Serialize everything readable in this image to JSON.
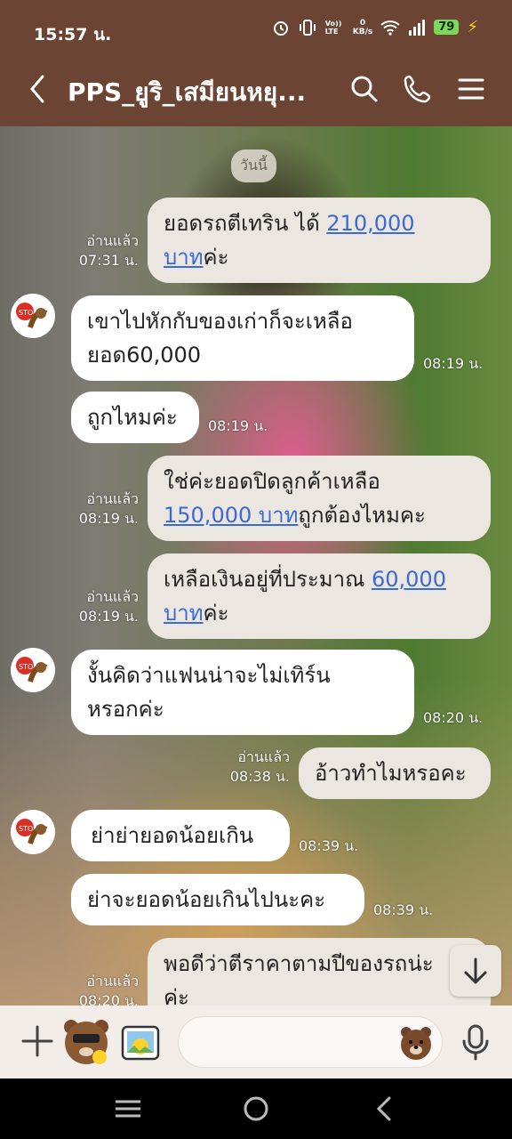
{
  "status_bar": {
    "time": "15:57 น.",
    "net_up": "0",
    "net_unit": "KB/s",
    "volte": "Vo)) LTE",
    "battery": "79",
    "icons": [
      "alarm-icon",
      "vibrate-icon",
      "volte-icon",
      "wifi-icon",
      "signal-icon",
      "battery-icon",
      "charging-icon"
    ]
  },
  "header": {
    "title": "PPS_ยูริ_เสมียนหยุ...",
    "icons": [
      "back-icon",
      "search-icon",
      "call-icon",
      "menu-icon"
    ]
  },
  "chat": {
    "date_chip": "วันนี้",
    "messages": [
      {
        "dir": "out",
        "read": "อ่านแล้ว",
        "time": "07:31 น.",
        "text1": "ยอดรถตีเทริน ได้ ",
        "link1": "210,000",
        "text2": "",
        "link2": "บาท",
        "text3": "ค่ะ"
      },
      {
        "dir": "in",
        "time": "08:19 น.",
        "line1": "เขาไปหักกับของเก่าก็จะเหลือ",
        "line2": "ยอด60,000"
      },
      {
        "dir": "in",
        "time": "08:19 น.",
        "line1": "ถูกไหมค่ะ"
      },
      {
        "dir": "out",
        "read": "อ่านแล้ว",
        "time": "08:19 น.",
        "line1": "ใช่ค่ะยอดปิดลูกค้าเหลือ",
        "link": "150,000 บาท",
        "tail": "ถูกต้องไหมคะ"
      },
      {
        "dir": "out",
        "read": "อ่านแล้ว",
        "time": "08:19 น.",
        "text1": "เหลือเงินอยู่ที่ประมาณ ",
        "link1": "60,000",
        "link2": "บาท",
        "text3": "ค่ะ"
      },
      {
        "dir": "in",
        "time": "08:20 น.",
        "line1": "งั้นคิดว่าแฟนน่าจะไม่เทิร์น",
        "line2": "หรอกค่ะ"
      },
      {
        "dir": "out",
        "read": "อ่านแล้ว",
        "time": "08:38 น.",
        "line1": "อ้าวทำไมหรอคะ"
      },
      {
        "dir": "in",
        "time": "08:39 น.",
        "line1": "ย่าย่ายอดน้อยเกิน"
      },
      {
        "dir": "in",
        "time": "08:39 น.",
        "line1": "ย่าจะยอดน้อยเกินไปนะคะ"
      },
      {
        "dir": "out",
        "read": "อ่านแล้ว",
        "time": "08:20 น.",
        "line1": "พอดีว่าตีราคาตามปีของรถน่ะ",
        "line2": "ค่ะ"
      }
    ]
  },
  "input_bar": {
    "placeholder": "",
    "icons": [
      "plus-icon",
      "sticker-bear-icon",
      "photo-sticker-icon",
      "emoji-icon",
      "mic-icon"
    ]
  },
  "nav_bar": {
    "icons": [
      "recent-apps-icon",
      "home-icon",
      "back-nav-icon"
    ]
  },
  "colors": {
    "header": "#6b4433",
    "outgoing_bubble": "#ece6e0",
    "incoming_bubble": "#ffffff",
    "link": "#3a6ad8"
  }
}
